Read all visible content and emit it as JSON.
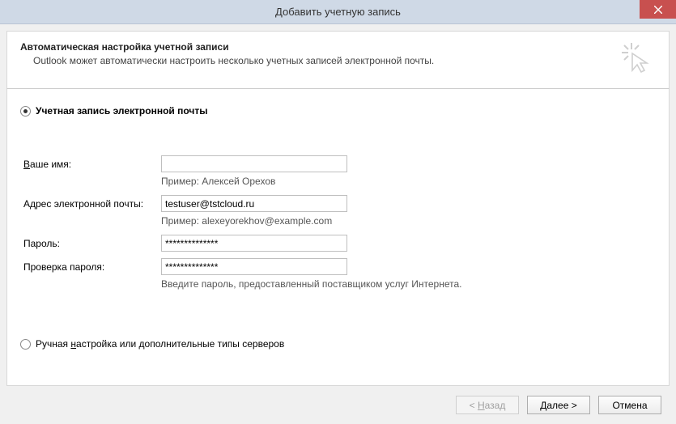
{
  "window": {
    "title": "Добавить учетную запись"
  },
  "header": {
    "title": "Автоматическая настройка учетной записи",
    "subtitle": "Outlook может автоматически настроить несколько учетных записей электронной почты."
  },
  "radio": {
    "email_account": "Учетная запись электронной почты",
    "manual_pre": "Ручная ",
    "manual_u": "н",
    "manual_post": "астройка или дополнительные типы серверов"
  },
  "form": {
    "name_label_u": "В",
    "name_label_post": "аше имя:",
    "name_value": "",
    "name_hint": "Пример: Алексей Орехов",
    "email_label": "Адрес электронной почты:",
    "email_value": "testuser@tstcloud.ru",
    "email_hint": "Пример: alexeyorekhov@example.com",
    "password_label": "Пароль:",
    "password_value": "**************",
    "confirm_label": "Проверка пароля:",
    "confirm_value": "**************",
    "password_hint": "Введите пароль, предоставленный поставщиком услуг Интернета."
  },
  "buttons": {
    "back_pre": "< ",
    "back_u": "Н",
    "back_post": "азад",
    "next_u": "Д",
    "next_post": "алее >",
    "cancel": "Отмена"
  }
}
